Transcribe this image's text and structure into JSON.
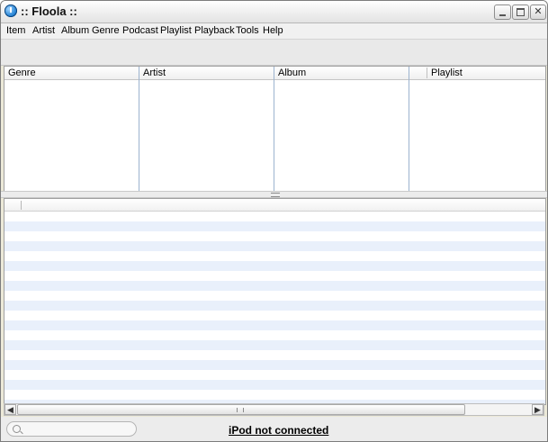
{
  "window": {
    "title": ":: Floola ::"
  },
  "menu": [
    {
      "label": "Item"
    },
    {
      "label": "Artist"
    },
    {
      "label": "Album"
    },
    {
      "label": "Genre"
    },
    {
      "label": "Podcast"
    },
    {
      "label": "Playlist"
    },
    {
      "label": "Playback"
    },
    {
      "label": "Tools"
    },
    {
      "label": "Help"
    }
  ],
  "browser": {
    "columns": [
      {
        "label": "Genre"
      },
      {
        "label": "Artist"
      },
      {
        "label": "Album"
      },
      {
        "label": "Playlist"
      }
    ]
  },
  "search": {
    "placeholder": ""
  },
  "status": {
    "ipod": "iPod not connected"
  }
}
